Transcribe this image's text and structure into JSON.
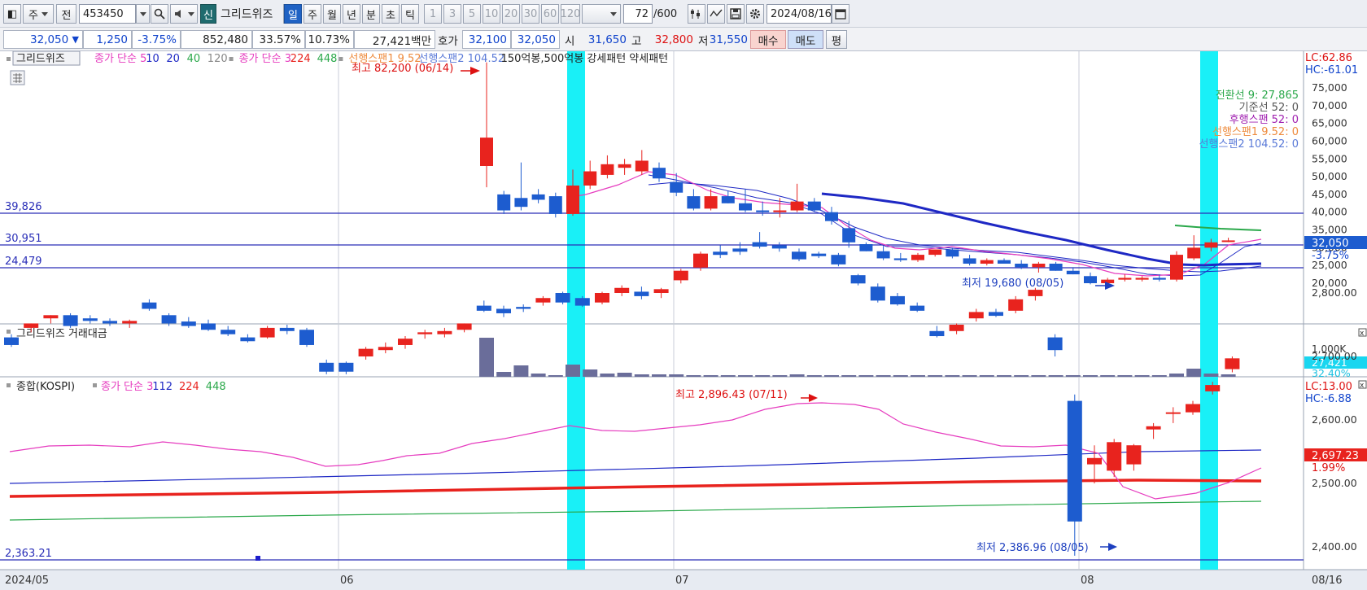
{
  "toolbar": {
    "market": "주",
    "prev_label": "전",
    "code": "453450",
    "new_badge": "신",
    "name": "그리드위즈",
    "periods": [
      "일",
      "주",
      "월",
      "년",
      "분",
      "초",
      "틱"
    ],
    "intervals": [
      "1",
      "3",
      "5",
      "10",
      "20",
      "30",
      "60",
      "120"
    ],
    "count_value": "72",
    "count_total": "/600",
    "date": "2024/08/16"
  },
  "quote": {
    "price": "32,050",
    "down_arrow": "▼",
    "change": "1,250",
    "change_pct": "-3.75%",
    "volume": "852,480",
    "ratio1": "33.57%",
    "ratio2": "10.73%",
    "amount": "27,421백만",
    "bid_label": "호가",
    "bid1": "32,100",
    "bid2": "32,050",
    "open_label": "시",
    "open": "31,650",
    "high_label": "고",
    "high": "32,800",
    "low_label": "저",
    "low": "31,550",
    "buy_label": "매수",
    "sell_label": "매도",
    "eval_label": "평"
  },
  "colors": {
    "up": "#e8231e",
    "down": "#1d5ccf",
    "highlight": "#19f0f7",
    "ma_pink": "#e63cbf",
    "trend": "#1e28c4",
    "kospi_ma": "#e8231e",
    "green": "#2aa84a"
  },
  "price_panel": {
    "name_tag": "그리드위즈",
    "legend": [
      {
        "text": "종가 단순 5",
        "color": "#e63cbf"
      },
      {
        "text": "10",
        "color": "#1e28c4"
      },
      {
        "text": "20",
        "color": "#1e28c4"
      },
      {
        "text": "40",
        "color": "#2aa84a"
      },
      {
        "text": "120",
        "color": "#888888"
      },
      {
        "text": "종가 단순 3",
        "color": "#e63cbf"
      },
      {
        "text": "224",
        "color": "#e8231e"
      },
      {
        "text": "448",
        "color": "#2aa84a"
      },
      {
        "text": "선행스팬1 9.52",
        "color": "#ee8a3c"
      },
      {
        "text": "선행스팬2 104.52",
        "color": "#5a7ad8"
      },
      {
        "text": "150억봉,500억봉 강세패턴  약세패턴",
        "color": "#222222"
      }
    ],
    "lc": "LC:62.86",
    "hc": "HC:-61.01",
    "yticks": [
      "75,000",
      "70,000",
      "65,000",
      "60,000",
      "55,000",
      "50,000",
      "45,000",
      "40,000",
      "35,000",
      "30,000",
      "25,000",
      "20,000"
    ],
    "hlines": [
      "39,826",
      "30,951",
      "24,479"
    ],
    "price_tag": "32,050",
    "pct_tag": "-3.75%",
    "high_note": "최고 82,200 (06/14)",
    "low_note": "최저 19,680 (08/05)",
    "ichimoku": [
      "전환선 9: 27,865",
      "기준선 52: 0",
      "후행스팬 52: 0",
      "선행스팬1 9.52: 0",
      "선행스팬2 104.52: 0"
    ]
  },
  "volume_panel": {
    "title": "그리드위즈 거래대금",
    "ytick": "1,000K",
    "value_tag": "27,421",
    "pct_tag": "32.40%"
  },
  "kospi_panel": {
    "title": "종합(KOSPI)",
    "legend": [
      {
        "text": "종가 단순 3",
        "color": "#e63cbf"
      },
      {
        "text": "112",
        "color": "#1e28c4"
      },
      {
        "text": "224",
        "color": "#e8231e"
      },
      {
        "text": "448",
        "color": "#2aa84a"
      }
    ],
    "lc": "LC:13.00",
    "hc": "HC:-6.88",
    "yticks": [
      "2,800.00",
      "2,700.00",
      "2,600.00",
      "2,500.00",
      "2,400.00"
    ],
    "hline": "2,363.21",
    "price_tag": "2,697.23",
    "pct_tag": "1.99%",
    "high_note": "최고 2,896.43 (07/11)",
    "low_note": "최저 2,386.96 (08/05)"
  },
  "xaxis": [
    "2024/05",
    "06",
    "07",
    "08"
  ],
  "xaxis_right": "08/16",
  "chart_data": {
    "type": "candlestick",
    "series": [
      {
        "name": "그리드위즈",
        "candles": [
          [
            53000,
            82200,
            47000,
            61000
          ],
          [
            45000,
            46000,
            39500,
            40500
          ],
          [
            44000,
            54000,
            40500,
            41500
          ],
          [
            45000,
            46500,
            42500,
            43500
          ],
          [
            44500,
            45500,
            38500,
            39500
          ],
          [
            39500,
            52000,
            39000,
            47500
          ],
          [
            47500,
            54500,
            46500,
            51500
          ],
          [
            50500,
            56000,
            49500,
            53500
          ],
          [
            52500,
            55000,
            50500,
            53500
          ],
          [
            51500,
            57500,
            50500,
            54500
          ],
          [
            52500,
            54000,
            48500,
            49500
          ],
          [
            48500,
            51000,
            44500,
            45500
          ],
          [
            44500,
            46500,
            40500,
            41000
          ],
          [
            41000,
            46500,
            40500,
            44500
          ],
          [
            44500,
            46000,
            42500,
            42500
          ],
          [
            42500,
            46500,
            40000,
            40500
          ],
          [
            40500,
            43000,
            39000,
            40000
          ],
          [
            40000,
            44000,
            38500,
            40500
          ],
          [
            40500,
            48000,
            40000,
            43000
          ],
          [
            43000,
            44000,
            40000,
            40500
          ],
          [
            40000,
            41500,
            36500,
            37500
          ],
          [
            35500,
            37500,
            30000,
            31500
          ],
          [
            31000,
            31500,
            29000,
            29000
          ],
          [
            29000,
            30500,
            26500,
            27000
          ],
          [
            27000,
            28500,
            26000,
            26500
          ],
          [
            26500,
            28500,
            26000,
            28000
          ],
          [
            28000,
            29500,
            27500,
            29500
          ],
          [
            29500,
            30000,
            27000,
            27500
          ],
          [
            27000,
            28000,
            25000,
            25500
          ],
          [
            25500,
            27000,
            25000,
            26500
          ],
          [
            26500,
            27000,
            25500,
            25500
          ],
          [
            25500,
            26500,
            24000,
            24500
          ],
          [
            24500,
            26000,
            23000,
            25500
          ],
          [
            25500,
            26000,
            23500,
            23500
          ],
          [
            23500,
            24500,
            22500,
            22500
          ],
          [
            22000,
            23000,
            19680,
            20000
          ],
          [
            20000,
            21500,
            19800,
            21000
          ],
          [
            21000,
            22500,
            20500,
            21500
          ],
          [
            21000,
            22000,
            20500,
            21500
          ],
          [
            21500,
            22500,
            20500,
            21000
          ],
          [
            21000,
            29000,
            20500,
            28000
          ],
          [
            27000,
            33500,
            26500,
            30000
          ],
          [
            30000,
            32500,
            29000,
            31500
          ],
          [
            31650,
            32800,
            31550,
            32050
          ]
        ]
      }
    ],
    "volume_tag": "27,421"
  }
}
